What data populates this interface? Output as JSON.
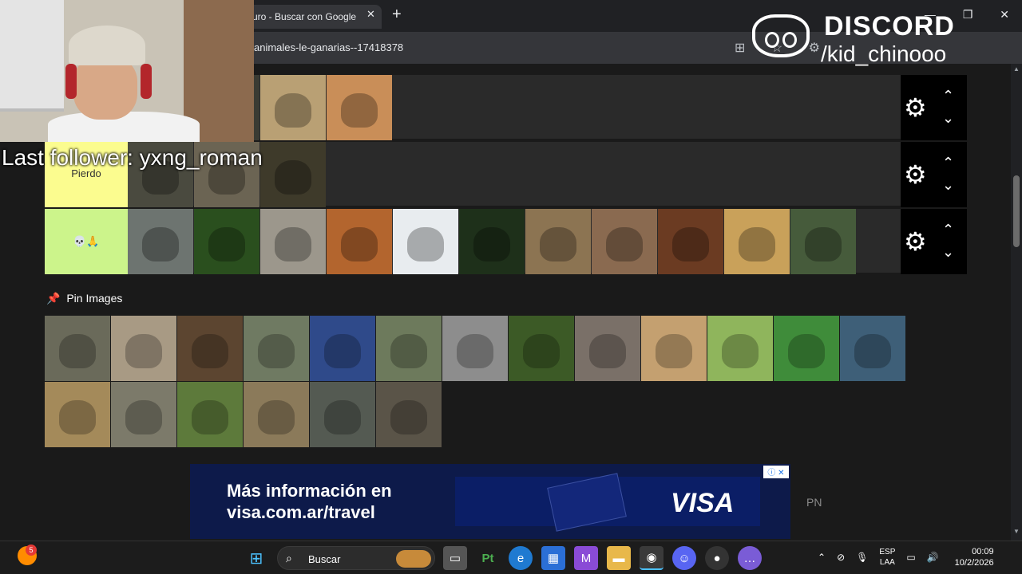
{
  "browser": {
    "tab_title": "uro - Buscar con Google",
    "tab_close": "✕",
    "new_tab": "+",
    "url": "animales-le-ganarias--17418378",
    "window_controls": [
      "—",
      "❐",
      "✕"
    ]
  },
  "tiers": [
    {
      "label": "",
      "color": "#1a1a1a",
      "tiles": [
        "#d8d4cc",
        "#3b3b33",
        "#b9a074",
        "#c98e58"
      ]
    },
    {
      "label": "Pierdo",
      "color": "#fbfc8f",
      "tiles": [
        "#4a4a3f",
        "#6b6453",
        "#3e3a2a"
      ]
    },
    {
      "label": "💀🙏",
      "color": "#ccf48b",
      "tiles": [
        "#6d7470",
        "#2a4f1e",
        "#9c978c",
        "#b3652e",
        "#e8ecef",
        "#1e301a",
        "#8c7452",
        "#8a6a50",
        "#6b3b22",
        "#c9a15a",
        "#465b3b"
      ]
    }
  ],
  "tier_controls": {
    "gear_icon": "gear-icon",
    "up_icon": "chevron-up-icon",
    "down_icon": "chevron-down-icon"
  },
  "pin": {
    "title": "Pin Images",
    "tiles": [
      "#6a6a5a",
      "#a89a84",
      "#5c4530",
      "#6f7a62",
      "#2f4a8a",
      "#6d7a5c",
      "#8d8d8d",
      "#3c5a26",
      "#7a7068",
      "#c4a070",
      "#8fb55c",
      "#3f8c3a",
      "#3e5f78",
      "#a48a5a",
      "#7c7a6a",
      "#5d7a3b",
      "#8b7a5a",
      "#545a52",
      "#5a5448"
    ]
  },
  "ad": {
    "line1": "Más información en",
    "line2": "visa.com.ar/travel",
    "brand": "VISA",
    "info": "ⓘ ✕",
    "side_text": "PN"
  },
  "overlay": {
    "last_follower": "Last follower: yxng_roman",
    "discord_title": "DISCORD",
    "discord_handle": "/kid_chinooo"
  },
  "taskbar": {
    "notification_badge": "5",
    "search_label": "Buscar",
    "lang_line1": "ESP",
    "lang_line2": "LAA",
    "time": "00:09",
    "date": "10/2/2026"
  }
}
